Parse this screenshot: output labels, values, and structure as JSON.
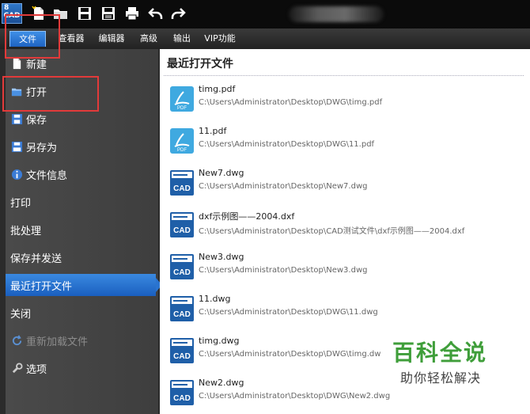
{
  "app": {
    "logo_text": "CAD",
    "logo_corner": "8"
  },
  "menu": {
    "tabs": [
      {
        "label": "文件",
        "active": true
      },
      {
        "label": "查看器"
      },
      {
        "label": "编辑器"
      },
      {
        "label": "高级"
      },
      {
        "label": "输出"
      },
      {
        "label": "VIP功能"
      }
    ]
  },
  "sidebar": {
    "items": [
      {
        "label": "新建",
        "icon": "new-file-icon"
      },
      {
        "label": "打开",
        "icon": "folder-open-icon"
      },
      {
        "label": "保存",
        "icon": "save-icon"
      },
      {
        "label": "另存为",
        "icon": "save-as-icon"
      },
      {
        "label": "文件信息",
        "icon": "info-icon"
      },
      {
        "label": "打印"
      },
      {
        "label": "批处理"
      },
      {
        "label": "保存并发送"
      },
      {
        "label": "最近打开文件",
        "selected": true
      },
      {
        "label": "关闭"
      },
      {
        "label": "重新加载文件",
        "icon": "reload-icon",
        "disabled": true
      },
      {
        "label": "选项",
        "icon": "wrench-icon"
      }
    ]
  },
  "main": {
    "title": "最近打开文件",
    "files": [
      {
        "name": "timg.pdf",
        "path": "C:\\Users\\Administrator\\Desktop\\DWG\\timg.pdf",
        "type": "pdf"
      },
      {
        "name": "11.pdf",
        "path": "C:\\Users\\Administrator\\Desktop\\DWG\\11.pdf",
        "type": "pdf"
      },
      {
        "name": "New7.dwg",
        "path": "C:\\Users\\Administrator\\Desktop\\New7.dwg",
        "type": "cad"
      },
      {
        "name": "dxf示例图——2004.dxf",
        "path": "C:\\Users\\Administrator\\Desktop\\CAD测试文件\\dxf示例图——2004.dxf",
        "type": "cad"
      },
      {
        "name": "New3.dwg",
        "path": "C:\\Users\\Administrator\\Desktop\\New3.dwg",
        "type": "cad"
      },
      {
        "name": "11.dwg",
        "path": "C:\\Users\\Administrator\\Desktop\\DWG\\11.dwg",
        "type": "cad"
      },
      {
        "name": "timg.dwg",
        "path": "C:\\Users\\Administrator\\Desktop\\DWG\\timg.dw",
        "type": "cad"
      },
      {
        "name": "New2.dwg",
        "path": "C:\\Users\\Administrator\\Desktop\\DWG\\New2.dwg",
        "type": "cad"
      }
    ],
    "pdf_icon_label": "PDF",
    "cad_icon_label": "CAD"
  },
  "watermark": {
    "title": "百科全说",
    "subtitle": "助你轻松解决"
  },
  "colors": {
    "accent": "#1e63c2",
    "highlight_box": "#e23a3a",
    "watermark_green": "#3f9e3a"
  }
}
